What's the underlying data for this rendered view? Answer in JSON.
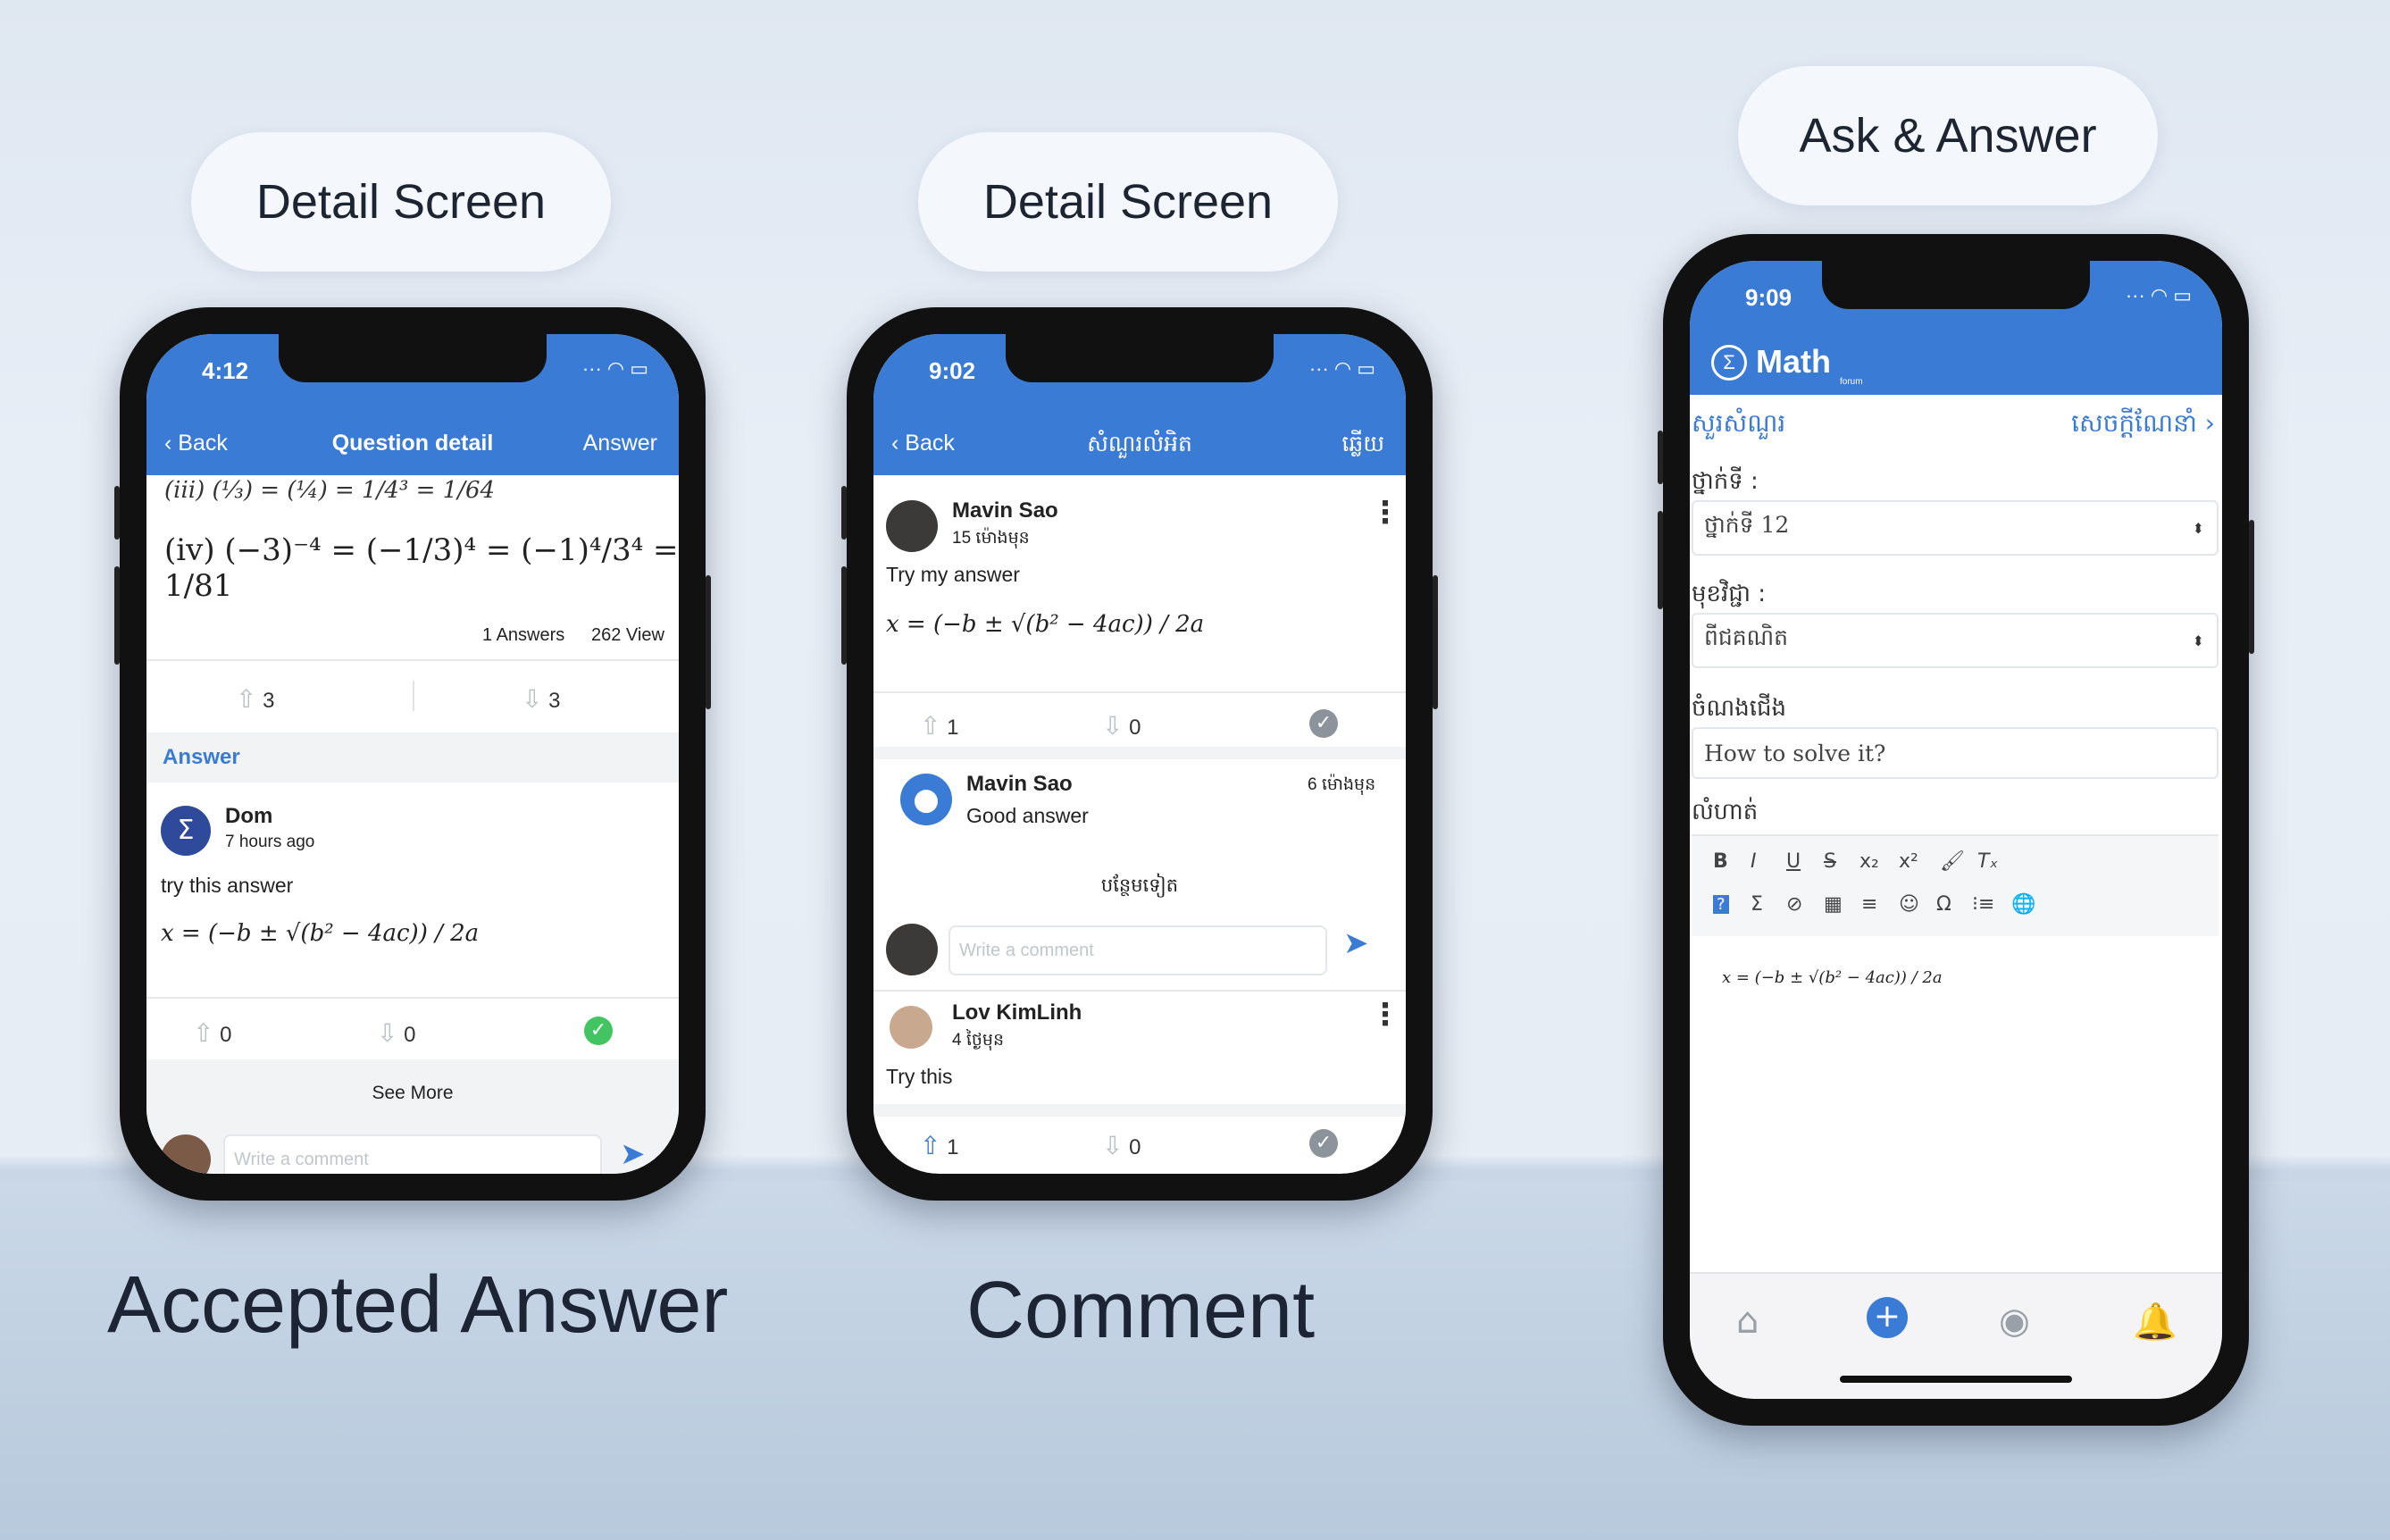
{
  "labels": {
    "pill1": "Detail Screen",
    "pill2": "Detail Screen",
    "pill3": "Ask & Answer",
    "caption1": "Accepted Answer",
    "caption2": "Comment"
  },
  "phone1": {
    "time": "4:12",
    "back": "Back",
    "title": "Question detail",
    "action": "Answer",
    "math_iv": "(iv) (−3)⁻⁴ = (−1/3)⁴ = (−1)⁴/3⁴ = 1/81",
    "answers_count": "1 Answers",
    "views": "262 View",
    "q_up": "3",
    "q_down": "3",
    "section": "Answer",
    "user": "Dom",
    "ago": "7 hours ago",
    "body": "try this answer",
    "formula": "x = (−b ± √(b² − 4ac)) / 2a",
    "a_up": "0",
    "a_down": "0",
    "see_more": "See More",
    "comment_placeholder": "Write a comment"
  },
  "phone2": {
    "time": "9:02",
    "back": "Back",
    "title": "សំណួរលំអិត",
    "action": "ឆ្លើយ",
    "user1": "Mavin Sao",
    "ago1": "15 ម៉ោងមុន",
    "body1": "Try my answer",
    "formula": "x = (−b ± √(b² − 4ac)) / 2a",
    "up1": "1",
    "down1": "0",
    "comment_user": "Mavin Sao",
    "comment_ago": "6 ម៉ោងមុន",
    "comment_text": "Good answer",
    "more": "បន្ថែមទៀត",
    "comment_placeholder": "Write a comment",
    "user2": "Lov KimLinh",
    "ago2": "4 ថ្ងៃមុន",
    "body2": "Try this",
    "up2": "1",
    "down2": "0"
  },
  "phone3": {
    "time": "9:09",
    "brand": "Math",
    "brand_sub": "forum",
    "left_link": "សួរសំណួរ",
    "right_link": "សេចក្តីណែនាំ",
    "grade_label": "ថ្នាក់ទី :",
    "grade_value": "ថ្នាក់ទី 12",
    "subject_label": "មុខវិជ្ជា :",
    "subject_value": "ពីជគណិត",
    "title_label": "ចំណងជើង",
    "title_value": "How to solve it?",
    "detail_label": "លំហាត់",
    "editor_formula": "x = (−b ± √(b² − 4ac)) / 2a",
    "toolbar_row1": [
      "B",
      "I",
      "U",
      "S",
      "x₂",
      "x²",
      "🖌",
      "Tₓ"
    ],
    "toolbar_row2": [
      "?",
      "Σ",
      "⊘",
      "▦",
      "≡",
      "☺",
      "Ω",
      "⁝≡",
      "🌐"
    ]
  },
  "colors": {
    "brand_blue": "#3a7bd5",
    "accept_green": "#43c463",
    "neutral_grey": "#8c939b"
  }
}
